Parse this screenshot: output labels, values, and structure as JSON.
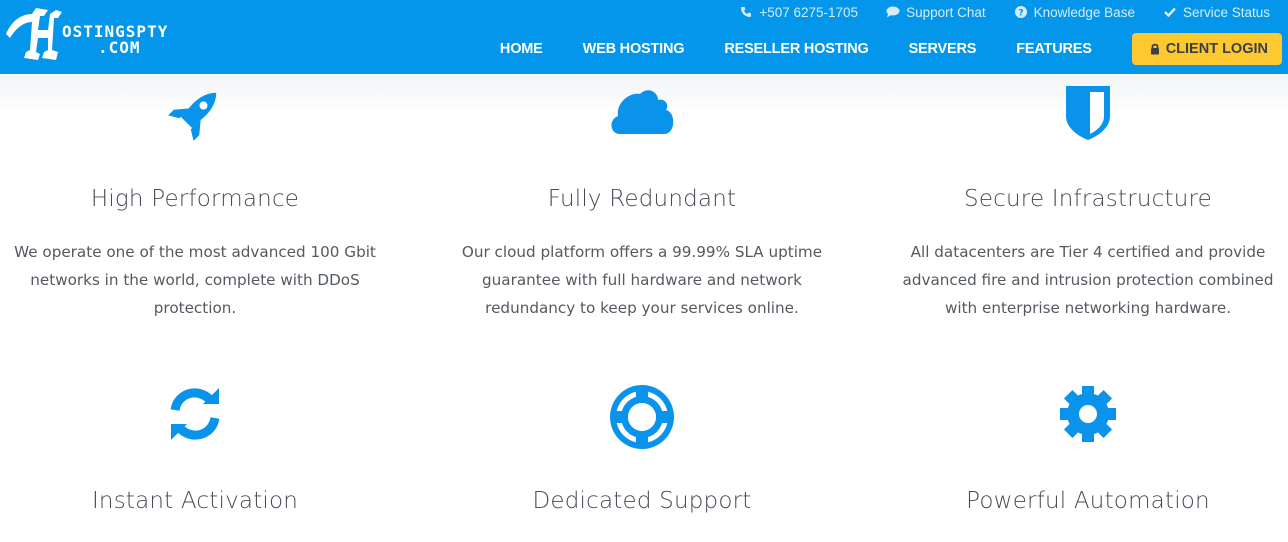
{
  "brand": {
    "name_line1": "OSTINGSPTY",
    "name_line2": ".COM",
    "primary_color": "#0396ea",
    "accent_color": "#fdc830"
  },
  "topbar": {
    "items": [
      {
        "icon": "phone-icon",
        "label": "+507 6275-1705"
      },
      {
        "icon": "chat-bubble-icon",
        "label": "Support Chat"
      },
      {
        "icon": "question-circle-icon",
        "label": "Knowledge Base"
      },
      {
        "icon": "checkmark-icon",
        "label": "Service Status"
      }
    ]
  },
  "nav": {
    "items": [
      {
        "label": "HOME"
      },
      {
        "label": "WEB HOSTING"
      },
      {
        "label": "RESELLER HOSTING"
      },
      {
        "label": "SERVERS"
      },
      {
        "label": "FEATURES"
      }
    ],
    "login_label": "CLIENT LOGIN",
    "login_icon": "lock-icon"
  },
  "features": [
    {
      "icon": "rocket-icon",
      "title": "High Performance",
      "desc": "We operate one of the most advanced 100 Gbit networks in the world, complete with DDoS protection."
    },
    {
      "icon": "cloud-icon",
      "title": "Fully Redundant",
      "desc": "Our cloud platform offers a 99.99% SLA uptime guarantee with full hardware and network redundancy to keep your services online."
    },
    {
      "icon": "shield-icon",
      "title": "Secure Infrastructure",
      "desc": "All datacenters are Tier 4 certified and provide advanced fire and intrusion protection combined with enterprise networking hardware."
    },
    {
      "icon": "refresh-icon",
      "title": "Instant Activation"
    },
    {
      "icon": "life-ring-icon",
      "title": "Dedicated Support"
    },
    {
      "icon": "gear-icon",
      "title": "Powerful Automation"
    }
  ]
}
